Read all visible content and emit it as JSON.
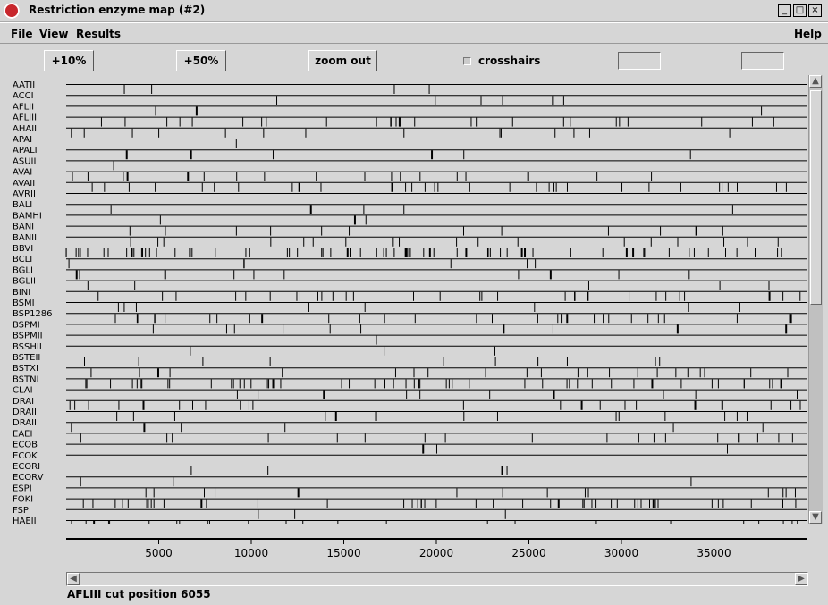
{
  "window": {
    "title": "Restriction enzyme map (#2)"
  },
  "menu": {
    "file": "File",
    "view": "View",
    "results": "Results",
    "help": "Help"
  },
  "toolbar": {
    "zoom_in_10": "+10%",
    "zoom_in_50": "+50%",
    "zoom_out": "zoom out",
    "crosshairs_label": "crosshairs",
    "crosshairs_checked": false,
    "field_a": "",
    "field_b": ""
  },
  "enzymes": [
    "AATII",
    "ACCI",
    "AFLII",
    "AFLIII",
    "AHAII",
    "APAI",
    "APALI",
    "ASUII",
    "AVAI",
    "AVAII",
    "AVRII",
    "BALI",
    "BAMHI",
    "BANI",
    "BANII",
    "BBVI",
    "BCLI",
    "BGLI",
    "BGLII",
    "BINI",
    "BSMI",
    "BSP1286",
    "BSPMI",
    "BSPMII",
    "BSSHII",
    "BSTEII",
    "BSTXI",
    "BSTNI",
    "CLAI",
    "DRAI",
    "DRAII",
    "DRAIII",
    "EAEI",
    "ECOB",
    "ECOK",
    "ECORI",
    "ECORV",
    "ESPI",
    "FOKI",
    "FSPI",
    "HAEII"
  ],
  "sequence_length": 40000,
  "axis": {
    "ticks": [
      5000,
      10000,
      15000,
      20000,
      25000,
      30000,
      35000
    ]
  },
  "status": "AFLIII cut position 6055"
}
